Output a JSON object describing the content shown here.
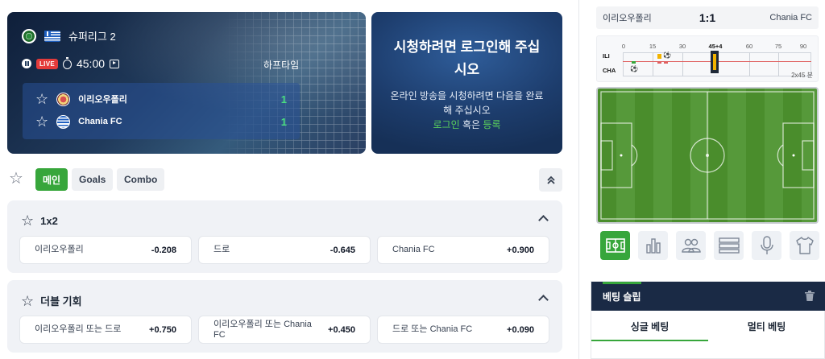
{
  "match": {
    "league": "슈퍼리그 2",
    "live_label": "LIVE",
    "clock": "45:00",
    "status": "하프타임",
    "home": {
      "name": "이리오우폴리",
      "score": "1"
    },
    "away": {
      "name": "Chania FC",
      "score": "1"
    }
  },
  "stream": {
    "title": "시청하려면 로그인해 주십시오",
    "description": "온라인 방송을 시청하려면 다음을 완료해 주십시오",
    "login_link": "로그인",
    "or_text": "혹은",
    "register_link": "등록"
  },
  "market_tabs": [
    {
      "label": "메인",
      "active": true
    },
    {
      "label": "Goals",
      "active": false
    },
    {
      "label": "Combo",
      "active": false
    }
  ],
  "markets": [
    {
      "title": "1x2",
      "odds": [
        {
          "label": "이리오우폴리",
          "value": "-0.208"
        },
        {
          "label": "드로",
          "value": "-0.645"
        },
        {
          "label": "Chania FC",
          "value": "+0.900"
        }
      ]
    },
    {
      "title": "더블 기회",
      "odds": [
        {
          "label": "이리오우폴리 또는 드로",
          "value": "+0.750"
        },
        {
          "label": "이리오우폴리 또는 Chania FC",
          "value": "+0.450"
        },
        {
          "label": "드로 또는 Chania FC",
          "value": "+0.090"
        }
      ]
    }
  ],
  "scoreboard": {
    "home": "이리오우폴리",
    "score": "1:1",
    "away": "Chania FC"
  },
  "timeline": {
    "ticks": [
      "0",
      "15",
      "30",
      "45+4",
      "60",
      "75",
      "90"
    ],
    "home_abbr": "ILI",
    "away_abbr": "CHA",
    "footer": "2x45 분"
  },
  "tools": [
    "pitch-icon",
    "stats-icon",
    "lineups-icon",
    "list-icon",
    "microphone-icon",
    "jersey-icon"
  ],
  "betslip": {
    "title": "베팅 슬립",
    "tabs": [
      {
        "label": "싱글 베팅",
        "active": true
      },
      {
        "label": "멀티 베팅",
        "active": false
      }
    ]
  },
  "colors": {
    "accent": "#37a63b",
    "score_green": "#4ade80",
    "live_red": "#e43b3b",
    "header_dark": "#1a2a45"
  }
}
